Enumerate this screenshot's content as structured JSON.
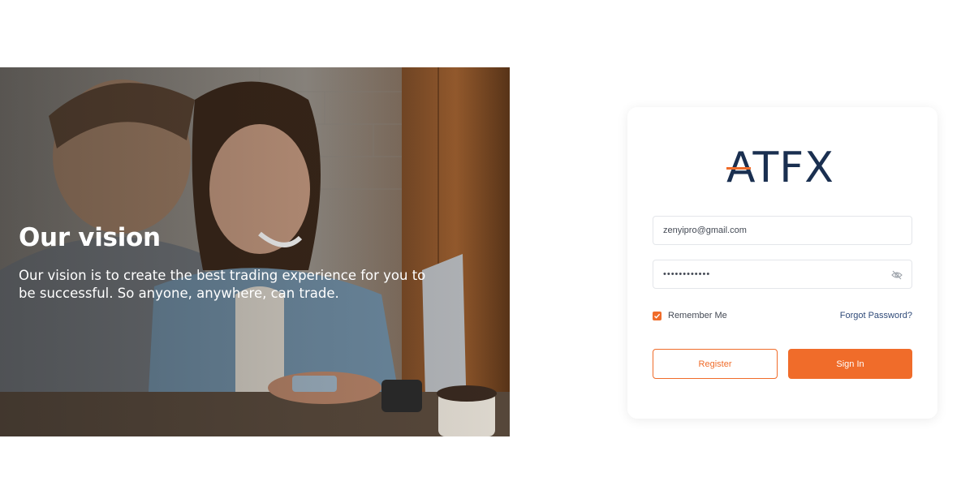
{
  "hero": {
    "title": "Our vision",
    "text": "Our vision is to create the best trading experience for you to be successful. So anyone, anywhere, can trade."
  },
  "login": {
    "logo_text": "ATFX",
    "email": {
      "value": "zenyipro@gmail.com"
    },
    "password": {
      "value": "••••••••••••"
    },
    "remember_label": "Remember Me",
    "remember_checked": true,
    "forgot_label": "Forgot Password?",
    "register_label": "Register",
    "signin_label": "Sign In"
  },
  "colors": {
    "accent": "#f06c2a",
    "brand_navy": "#1a2f50",
    "link": "#2f4a78"
  }
}
